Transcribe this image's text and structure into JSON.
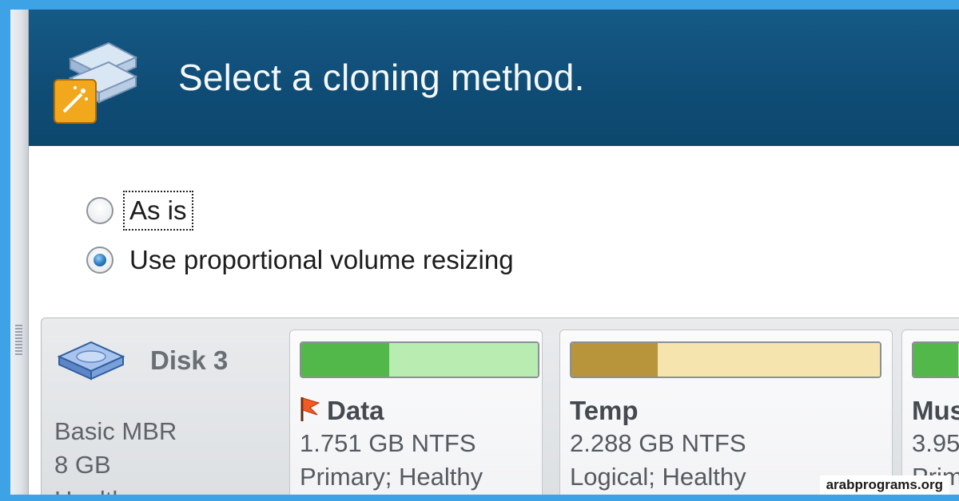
{
  "wizard": {
    "title": "Select a cloning method.",
    "icon": "clone-wizard-icon"
  },
  "options": [
    {
      "label": "As is",
      "checked": false,
      "focused": true
    },
    {
      "label": "Use proportional volume resizing",
      "checked": true,
      "focused": false
    }
  ],
  "disk": {
    "name": "Disk 3",
    "type": "Basic MBR",
    "size": "8 GB",
    "status": "Healthy",
    "icon": "hard-disk-icon"
  },
  "partitions": [
    {
      "name": "Data",
      "size": "1.751 GB NTFS",
      "status": "Primary; Healthy",
      "used_fraction": 0.37,
      "color": "#53b84a",
      "rest_color": "#b9ecb0",
      "flag": true
    },
    {
      "name": "Temp",
      "size": "2.288 GB NTFS",
      "status": "Logical; Healthy",
      "used_fraction": 0.28,
      "color": "#b8953a",
      "rest_color": "#f6e4ae",
      "flag": false
    },
    {
      "name": "Mus",
      "size": "3.95",
      "status": "Prim",
      "used_fraction": 0.3,
      "color": "#53b84a",
      "rest_color": "#b9ecb0",
      "flag": false
    }
  ],
  "watermark": "arabprograms.org"
}
